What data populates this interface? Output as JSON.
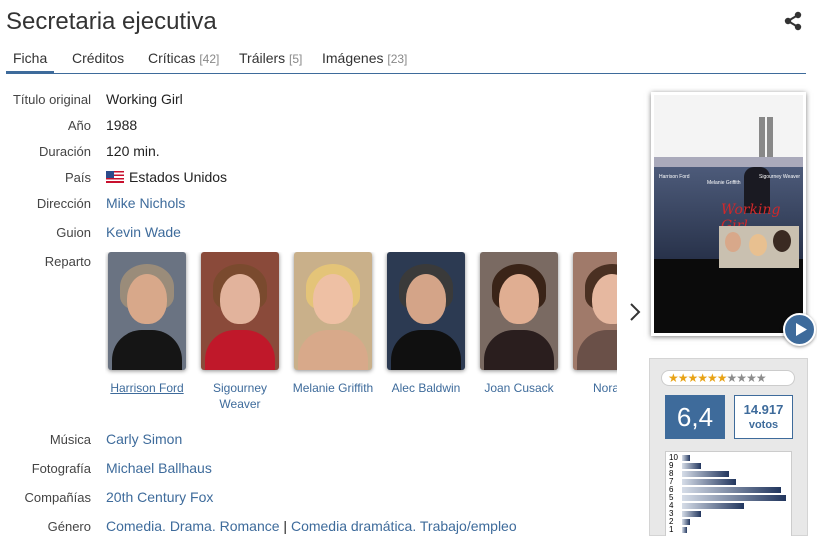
{
  "page": {
    "title": "Secretaria ejecutiva"
  },
  "tabs": [
    {
      "label": "Ficha",
      "count": ""
    },
    {
      "label": "Créditos",
      "count": ""
    },
    {
      "label": "Críticas",
      "count": "[42]"
    },
    {
      "label": "Tráilers",
      "count": "[5]"
    },
    {
      "label": "Imágenes",
      "count": "[23]"
    }
  ],
  "details": {
    "original_title": {
      "label": "Título original",
      "value": "Working Girl"
    },
    "year": {
      "label": "Año",
      "value": "1988"
    },
    "duration": {
      "label": "Duración",
      "value": "120 min."
    },
    "country": {
      "label": "País",
      "value": "Estados Unidos"
    },
    "director": {
      "label": "Dirección",
      "value": "Mike Nichols"
    },
    "screenplay": {
      "label": "Guion",
      "value": "Kevin Wade"
    },
    "cast_label": "Reparto",
    "music": {
      "label": "Música",
      "value": "Carly Simon"
    },
    "photography": {
      "label": "Fotografía",
      "value": "Michael Ballhaus"
    },
    "companies": {
      "label": "Compañías",
      "value": "20th Century Fox"
    },
    "genre": {
      "label": "Género",
      "group1": [
        "Comedia",
        "Drama",
        "Romance"
      ],
      "separator": "|",
      "group2": [
        "Comedia dramática",
        "Trabajo/empleo"
      ]
    }
  },
  "cast": [
    {
      "name": "Harrison Ford",
      "name2": ""
    },
    {
      "name": "Sigourney",
      "name2": "Weaver"
    },
    {
      "name": "Melanie Griffith",
      "name2": ""
    },
    {
      "name": "Alec Baldwin",
      "name2": ""
    },
    {
      "name": "Joan Cusack",
      "name2": ""
    },
    {
      "name": "Nora D",
      "name2": ""
    }
  ],
  "poster": {
    "actor1": "Harrison Ford",
    "actor2": "Melanie Griffith",
    "actor3": "Sigourney Weaver",
    "logo": "Working Girl"
  },
  "rating": {
    "average": "6,4",
    "votes_count": "14.917",
    "votes_label": "votos",
    "stars_filled": 6,
    "stars_total": 10,
    "histogram_labels": [
      "10",
      "9",
      "8",
      "7",
      "6",
      "5",
      "4",
      "3",
      "2",
      "1"
    ],
    "histogram_fractions": [
      0.08,
      0.18,
      0.45,
      0.52,
      0.95,
      1.0,
      0.6,
      0.18,
      0.08,
      0.05
    ]
  },
  "colors": {
    "accent": "#3e6b9b",
    "star": "#e8a317"
  }
}
